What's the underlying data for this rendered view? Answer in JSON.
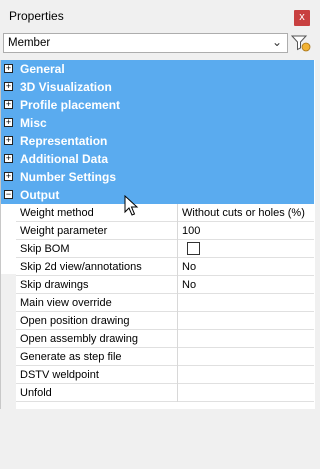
{
  "window": {
    "title": "Properties",
    "close_glyph": "x"
  },
  "selector": {
    "value": "Member",
    "chevron": "⌄"
  },
  "filter_icon": "filter-icon",
  "categories": [
    {
      "label": "General"
    },
    {
      "label": "3D Visualization"
    },
    {
      "label": "Profile placement"
    },
    {
      "label": "Misc"
    },
    {
      "label": "Representation"
    },
    {
      "label": "Additional Data"
    },
    {
      "label": "Number Settings"
    },
    {
      "label": "Output",
      "expanded": true
    }
  ],
  "expander": {
    "collapsed": "+",
    "expanded": "−"
  },
  "output_rows": [
    {
      "name": "Weight method",
      "value": "Without cuts or holes (%)"
    },
    {
      "name": "Weight parameter",
      "value": "100"
    },
    {
      "name": "Skip BOM",
      "checkbox": true,
      "checked": false
    },
    {
      "name": "Skip 2d view/annotations",
      "value": "No"
    },
    {
      "name": "Skip drawings",
      "value": "No"
    },
    {
      "name": "Main view override",
      "value": ""
    },
    {
      "name": "Open position drawing",
      "value": ""
    },
    {
      "name": "Open assembly drawing",
      "value": ""
    },
    {
      "name": "Generate as step file",
      "value": ""
    },
    {
      "name": "DSTV weldpoint",
      "value": ""
    },
    {
      "name": "Unfold",
      "value": ""
    }
  ],
  "colors": {
    "selection": "#5aabef",
    "close": "#c84040"
  }
}
